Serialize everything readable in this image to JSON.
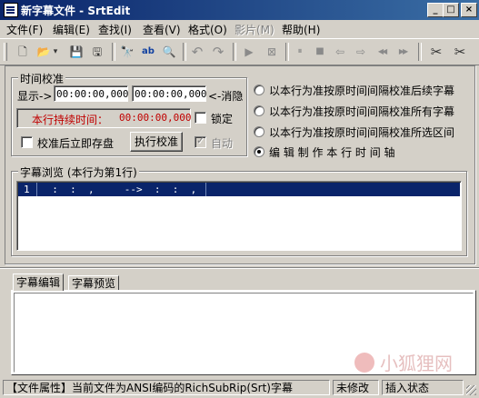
{
  "window": {
    "title": "新字幕文件 - SrtEdit",
    "buttons": {
      "minimize": "_",
      "maximize": "□",
      "close": "×"
    }
  },
  "menu": [
    {
      "label": "文件(F)",
      "enabled": true
    },
    {
      "label": "编辑(E)",
      "enabled": true
    },
    {
      "label": "查找(I)",
      "enabled": true
    },
    {
      "label": "查看(V)",
      "enabled": true
    },
    {
      "label": "格式(O)",
      "enabled": true
    },
    {
      "label": "影片(M)",
      "enabled": false
    },
    {
      "label": "帮助(H)",
      "enabled": true
    }
  ],
  "toolbar": {
    "icons": [
      {
        "name": "new-file-icon",
        "glyph": "🗋"
      },
      {
        "name": "open-folder-icon",
        "glyph": "📂"
      },
      {
        "name": "dropdown-arrow-icon",
        "glyph": "▾"
      },
      {
        "name": "save-icon",
        "glyph": "💾"
      },
      {
        "name": "save-all-icon",
        "glyph": "🖫"
      },
      {
        "name": "find-icon",
        "glyph": "🔭"
      },
      {
        "name": "replace-icon",
        "glyph": "ab"
      },
      {
        "name": "find-preview-icon",
        "glyph": "🔍"
      },
      {
        "name": "undo-icon",
        "glyph": "↶"
      },
      {
        "name": "redo-icon",
        "glyph": "↷"
      },
      {
        "name": "play-icon",
        "glyph": "▶"
      },
      {
        "name": "frame-icon",
        "glyph": "⊠"
      },
      {
        "name": "pause-icon",
        "glyph": "⏸"
      },
      {
        "name": "stop-icon",
        "glyph": "■"
      },
      {
        "name": "back-icon",
        "glyph": "⇦"
      },
      {
        "name": "forward-icon",
        "glyph": "⇨"
      },
      {
        "name": "rewind-icon",
        "glyph": "◀◀"
      },
      {
        "name": "fast-forward-icon",
        "glyph": "▶▶"
      },
      {
        "name": "strike-time-icon",
        "glyph": "✂"
      },
      {
        "name": "strike-time-alt-icon",
        "glyph": "✂"
      }
    ]
  },
  "calibration": {
    "legend": "时间校准",
    "show_label": "显示->",
    "time_start": "00:00:00,000",
    "time_end": "00:00:00,000",
    "eliminate_label": "<-消隐",
    "duration_label": "本行持续时间：",
    "duration_value": "00:00:00,000",
    "lock_label": "锁定",
    "save_after_label": "校准后立即存盘",
    "execute_button": "执行校准",
    "auto_label": "自动",
    "options": [
      {
        "label": "以本行为准按原时间间隔校准后续字幕",
        "selected": false
      },
      {
        "label": "以本行为准按原时间间隔校准所有字幕",
        "selected": false
      },
      {
        "label": "以本行为准按原时间间隔校准所选区间",
        "selected": false
      },
      {
        "label": "编 辑 制 作 本 行 时 间 轴",
        "selected": true
      }
    ]
  },
  "browser": {
    "legend": "字幕浏览 (本行为第1行)",
    "row": {
      "index": "1",
      "content": "  :  :  ,     -->  :  :  ,"
    }
  },
  "editor": {
    "tabs": [
      {
        "label": "字幕编辑",
        "active": true
      },
      {
        "label": "字幕预览",
        "active": false
      }
    ]
  },
  "status": {
    "file_info": "【文件属性】当前文件为ANSI编码的RichSubRip(Srt)字幕",
    "modified": "未修改",
    "mode": "插入状态"
  },
  "watermark": "小狐狸网",
  "colors": {
    "title_bar": "#0a246a",
    "selection": "#0a246a",
    "warning_text": "#c00000"
  }
}
